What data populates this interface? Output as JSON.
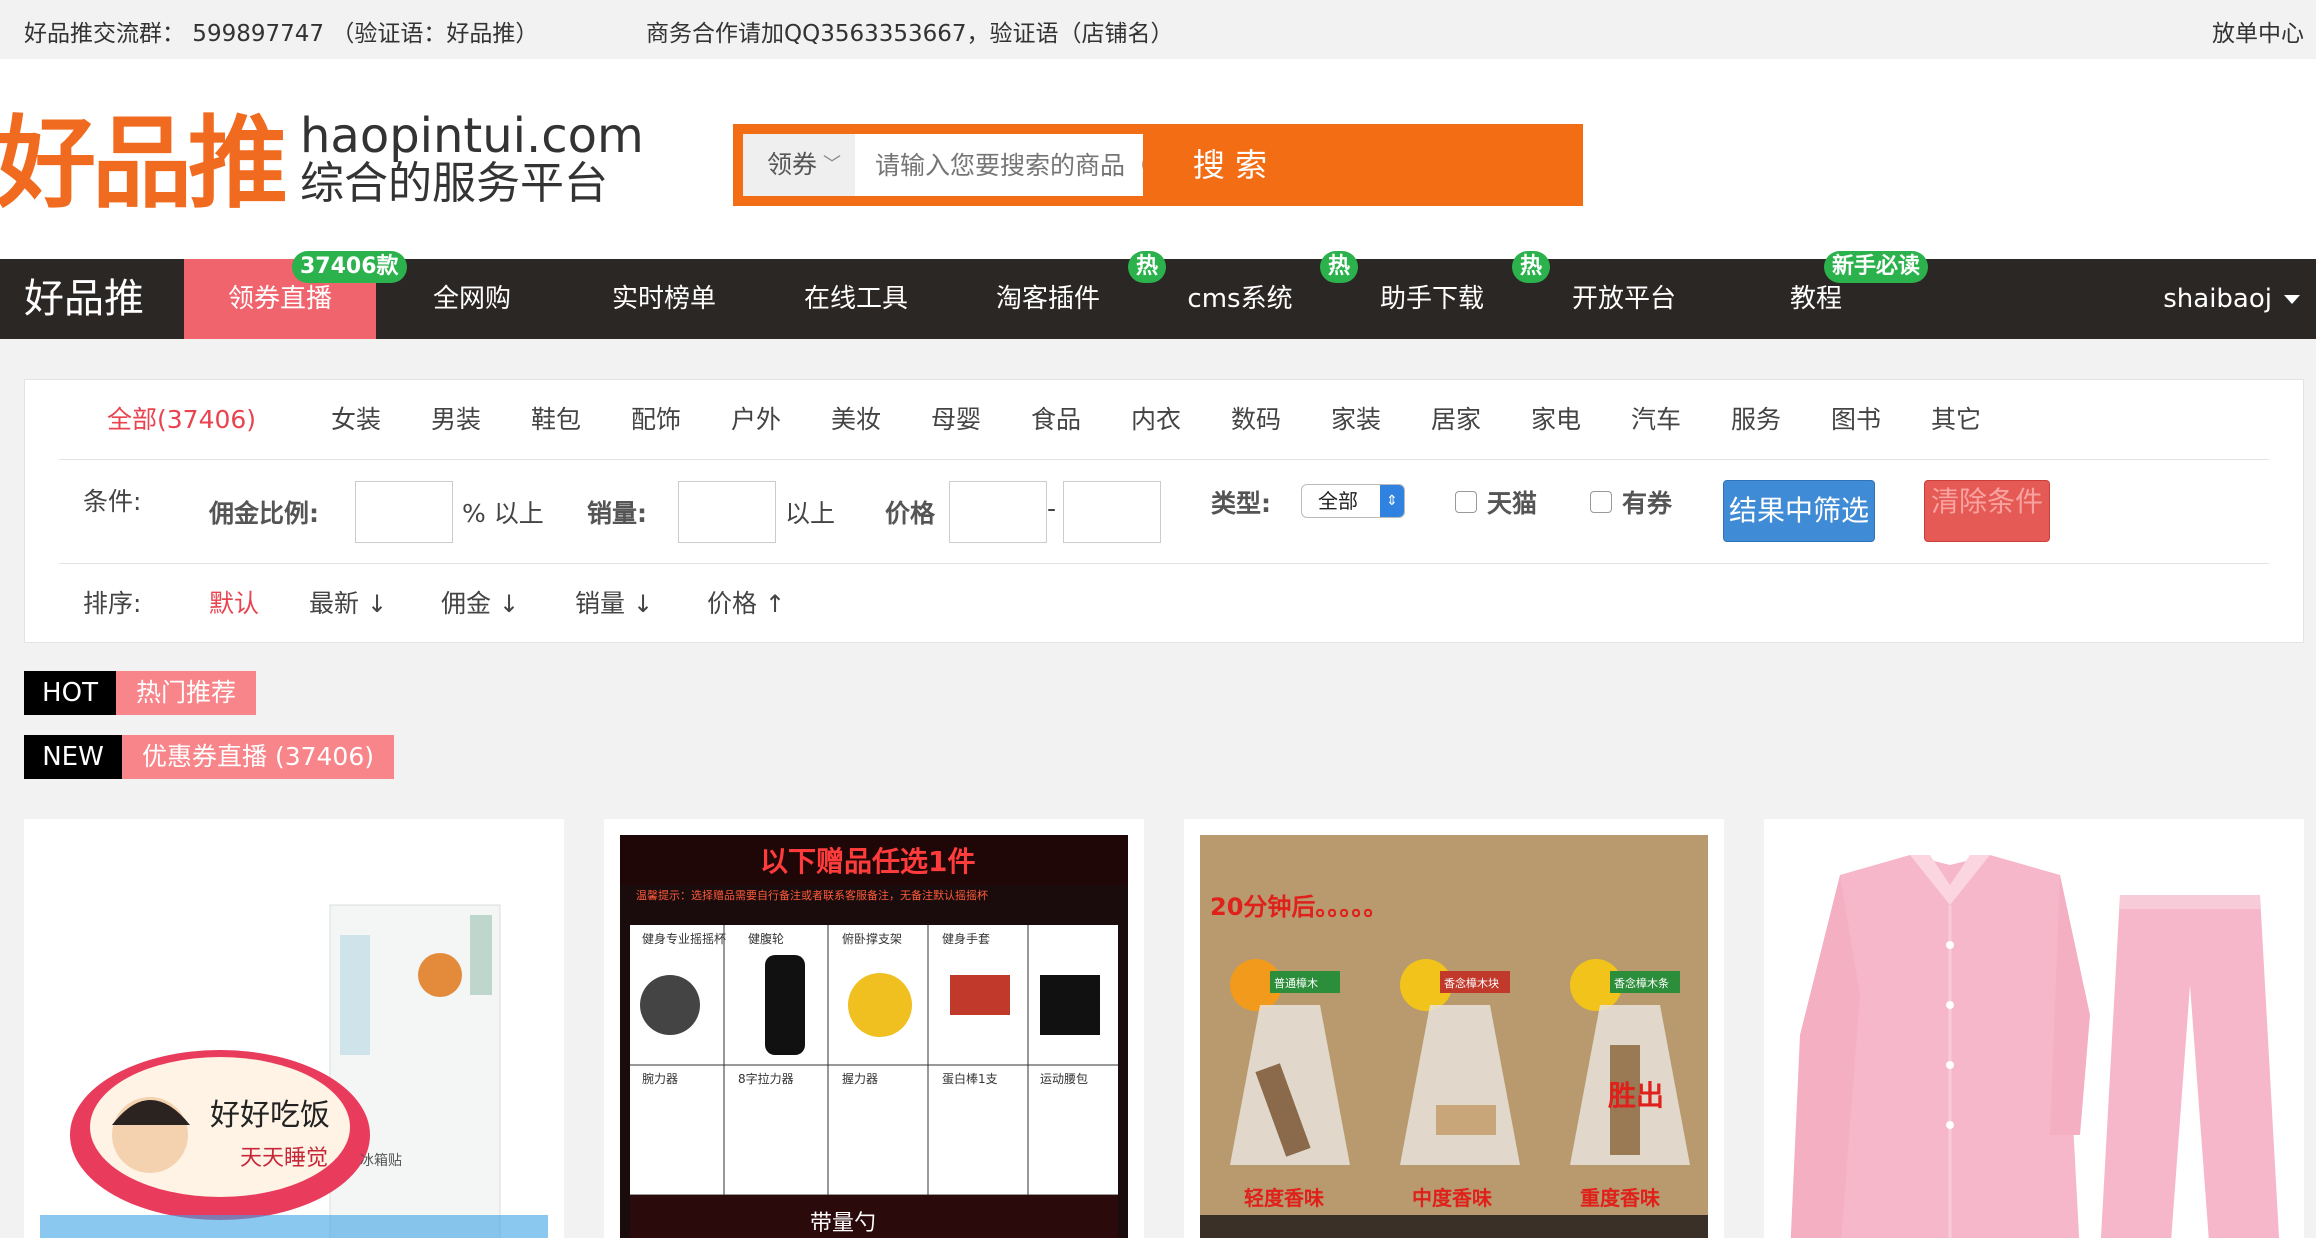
{
  "topbar": {
    "group": "好品推交流群： 599897747 （验证语：好品推）",
    "business": "商务合作请加QQ3563353667，验证语（店铺名）",
    "publish": "放单中心"
  },
  "header": {
    "logo_text": "好品推",
    "domain": "haopintui.com",
    "slogan": "综合的服务平台"
  },
  "search": {
    "category": "领券",
    "placeholder": "请输入您要搜索的商品（精选）关键词...",
    "button": "搜 索"
  },
  "nav": {
    "brand": "好品推",
    "items": [
      {
        "label": "领券直播",
        "badge": "37406款"
      },
      {
        "label": "全网购"
      },
      {
        "label": "实时榜单"
      },
      {
        "label": "在线工具"
      },
      {
        "label": "淘客插件",
        "badge": "热"
      },
      {
        "label": "cms系统",
        "badge": "热"
      },
      {
        "label": "助手下载",
        "badge": "热"
      },
      {
        "label": "开放平台"
      },
      {
        "label": "教程",
        "badge": "新手必读"
      }
    ],
    "user": "shaibaoj"
  },
  "filters": {
    "categories": [
      "全部(37406)",
      "女装",
      "男装",
      "鞋包",
      "配饰",
      "户外",
      "美妆",
      "母婴",
      "食品",
      "内衣",
      "数码",
      "家装",
      "居家",
      "家电",
      "汽车",
      "服务",
      "图书",
      "其它"
    ],
    "condition_label": "条件:",
    "commission_label": "佣金比例:",
    "commission_suffix": "% 以上",
    "sales_label": "销量:",
    "sales_suffix": "以上",
    "price_label": "价格",
    "price_dash": "-",
    "type_label": "类型:",
    "type_value": "全部",
    "tmall": "天猫",
    "coupon": "有券",
    "filter_button": "结果中筛选",
    "clear_button": "清除条件",
    "sort_label": "排序:",
    "sorts": [
      {
        "label": "默认",
        "arrow": ""
      },
      {
        "label": "最新",
        "arrow": "↓"
      },
      {
        "label": "佣金",
        "arrow": "↓"
      },
      {
        "label": "销量",
        "arrow": "↓"
      },
      {
        "label": "价格",
        "arrow": "↑"
      }
    ]
  },
  "sections": {
    "hot_tag": "HOT",
    "hot_label": "热门推荐",
    "new_tag": "NEW",
    "new_label": "优惠券直播 (37406)"
  },
  "products": [
    {
      "img_text_1": "好好吃饭",
      "img_text_2": "天天睡觉",
      "img_text_3": "冰箱贴"
    },
    {
      "img_title": "以下赠品任选1件",
      "img_note": "温馨提示：选择赠品需要自行备注或者联系客服备注，无备注默认摇摇杯",
      "items": [
        "健身专业摇摇杯",
        "健腹轮",
        "俯卧撑支架",
        "健身手套",
        "腕力器",
        "8字拉力器",
        "握力器",
        "蛋白棒1支",
        "运动腰包"
      ],
      "img_footer": "带量勺"
    },
    {
      "img_text": "20分钟后。。。。。",
      "labels": [
        "普通樟木",
        "香念樟木块",
        "香念樟木条"
      ],
      "bottom": [
        "轻度香味",
        "中度香味",
        "重度香味"
      ],
      "win": "胜出"
    },
    {
      "img_alt": "粉色睡衣"
    }
  ],
  "colors": {
    "brand_orange": "#f36d14",
    "nav_bg": "#2b2725",
    "active_pink": "#f0646e",
    "badge_green": "#2bb24c",
    "active_red": "#e8434f"
  }
}
